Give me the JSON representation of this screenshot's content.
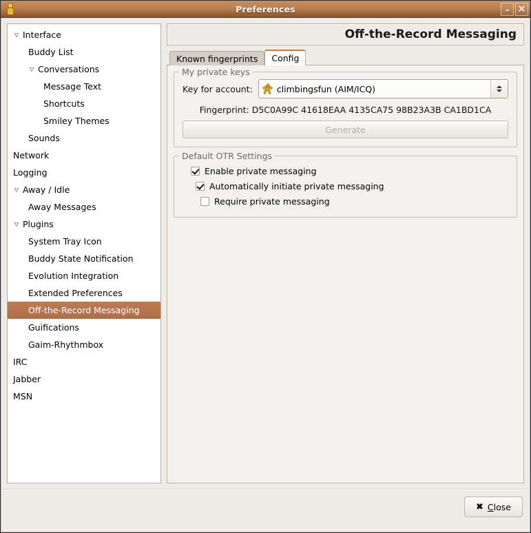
{
  "window": {
    "title": "Preferences",
    "icon": "gaim-logo-icon",
    "minimize_label": "–",
    "close_label": "✕"
  },
  "sidebar": {
    "items": [
      {
        "label": "Interface",
        "indent": 0,
        "arrow": "▽",
        "selected": false
      },
      {
        "label": "Buddy List",
        "indent": 1,
        "arrow": "",
        "selected": false
      },
      {
        "label": "Conversations",
        "indent": 1,
        "arrow": "▽",
        "selected": false
      },
      {
        "label": "Message Text",
        "indent": 2,
        "arrow": "",
        "selected": false
      },
      {
        "label": "Shortcuts",
        "indent": 2,
        "arrow": "",
        "selected": false
      },
      {
        "label": "Smiley Themes",
        "indent": 2,
        "arrow": "",
        "selected": false
      },
      {
        "label": "Sounds",
        "indent": 1,
        "arrow": "",
        "selected": false
      },
      {
        "label": "Network",
        "indent": 0,
        "arrow": "",
        "selected": false
      },
      {
        "label": "Logging",
        "indent": 0,
        "arrow": "",
        "selected": false
      },
      {
        "label": "Away / Idle",
        "indent": 0,
        "arrow": "▽",
        "selected": false
      },
      {
        "label": "Away Messages",
        "indent": 1,
        "arrow": "",
        "selected": false
      },
      {
        "label": "Plugins",
        "indent": 0,
        "arrow": "▽",
        "selected": false
      },
      {
        "label": "System Tray Icon",
        "indent": 1,
        "arrow": "",
        "selected": false
      },
      {
        "label": "Buddy State Notification",
        "indent": 1,
        "arrow": "",
        "selected": false
      },
      {
        "label": "Evolution Integration",
        "indent": 1,
        "arrow": "",
        "selected": false
      },
      {
        "label": "Extended Preferences",
        "indent": 1,
        "arrow": "",
        "selected": false
      },
      {
        "label": "Off-the-Record Messaging",
        "indent": 1,
        "arrow": "",
        "selected": true
      },
      {
        "label": "Guifications",
        "indent": 1,
        "arrow": "",
        "selected": false
      },
      {
        "label": "Gaim-Rhythmbox",
        "indent": 1,
        "arrow": "",
        "selected": false
      },
      {
        "label": "IRC",
        "indent": 0,
        "arrow": "",
        "selected": false
      },
      {
        "label": "Jabber",
        "indent": 0,
        "arrow": "",
        "selected": false
      },
      {
        "label": "MSN",
        "indent": 0,
        "arrow": "",
        "selected": false
      }
    ]
  },
  "main": {
    "panel_title": "Off-the-Record Messaging",
    "tabs": [
      {
        "label": "Known fingerprints",
        "active": false
      },
      {
        "label": "Config",
        "active": true
      }
    ],
    "private_keys": {
      "frame_title": "My private keys",
      "account_label": "Key for account:",
      "account_value": "climbingsfun (AIM/ICQ)",
      "account_icon": "buddy-person-icon",
      "fingerprint": "Fingerprint: D5C0A99C 41618EAA 4135CA75 98B23A3B CA1BD1CA",
      "generate_label": "Generate",
      "generate_enabled": false
    },
    "otr_settings": {
      "frame_title": "Default OTR Settings",
      "options": [
        {
          "label": "Enable private messaging",
          "checked": true,
          "level": 0
        },
        {
          "label": "Automatically initiate private messaging",
          "checked": true,
          "level": 1
        },
        {
          "label": "Require private messaging",
          "checked": false,
          "level": 2
        }
      ]
    }
  },
  "actions": {
    "close_icon": "✖",
    "close_prefix": "C",
    "close_rest": "lose"
  },
  "colors": {
    "titlebar_top": "#c98f60",
    "titlebar_bottom": "#8b5530",
    "selection": "#b06c45",
    "active_tab_accent": "#d2792f",
    "window_bg": "#efece7",
    "panel_bg": "#f3f1ed"
  }
}
